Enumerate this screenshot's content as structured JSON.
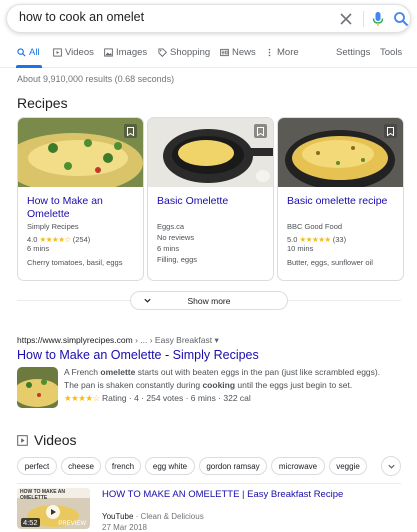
{
  "search": {
    "query": "how to cook an omelet"
  },
  "tabs": [
    {
      "label": "All",
      "icon": "search-icon"
    },
    {
      "label": "Videos",
      "icon": "video-icon"
    },
    {
      "label": "Images",
      "icon": "image-icon"
    },
    {
      "label": "Shopping",
      "icon": "tag-icon"
    },
    {
      "label": "News",
      "icon": "news-icon"
    },
    {
      "label": "More",
      "icon": "more-vert-icon"
    },
    {
      "label": "Settings"
    },
    {
      "label": "Tools"
    }
  ],
  "result_stats": "About 9,910,000 results (0.68 seconds)",
  "recipes": {
    "heading": "Recipes",
    "cards": [
      {
        "title": "How to Make an Omelette",
        "source": "Simply Recipes",
        "rating": "4.0",
        "stars": "★★★★☆",
        "votes": "(254)",
        "time": "6 mins",
        "ingredients": "Cherry tomatoes, basil, eggs"
      },
      {
        "title": "Basic Omelette",
        "source": "Eggs.ca",
        "rating_text": "No reviews",
        "time": "6 mins",
        "ingredients": "Filling, eggs"
      },
      {
        "title": "Basic omelette recipe",
        "source": "BBC Good Food",
        "rating": "5.0",
        "stars": "★★★★★",
        "votes": "(33)",
        "time": "10 mins",
        "ingredients": "Butter, eggs, sunflower oil"
      }
    ],
    "show_more": "Show more"
  },
  "web_result": {
    "url": "https://www.simplyrecipes.com",
    "path": " › ... › Easy Breakfast ▾",
    "title": "How to Make an Omelette - Simply Recipes",
    "snippet_1a": "A French ",
    "snippet_1b": "omelette",
    "snippet_1c": " starts out with beaten eggs in the pan (just like scrambled eggs).",
    "snippet_2a": "The pan is shaken constantly during ",
    "snippet_2b": "cooking",
    "snippet_2c": " until the eggs just begin to set.",
    "stars": "★★★★☆",
    "meta": " Rating · 4 · 254 votes · 6 mins · 322 cal"
  },
  "videos": {
    "heading": "Videos",
    "chips": [
      "perfect",
      "cheese",
      "french",
      "egg white",
      "gordon ramsay",
      "microwave",
      "veggie"
    ],
    "items": [
      {
        "title": "HOW TO MAKE AN OMELETTE | Easy Breakfast Recipe",
        "channel": "YouTube",
        "author": " · Clean & Delicious",
        "date": "27 Mar 2018",
        "duration": "4:52",
        "preview": "PREVIEW",
        "thumb_text": "HOW TO MAKE AN OMELETTE"
      }
    ]
  },
  "colors": {
    "link": "#1a0dab",
    "accent": "#1a73e8",
    "star": "#fbbc04"
  }
}
